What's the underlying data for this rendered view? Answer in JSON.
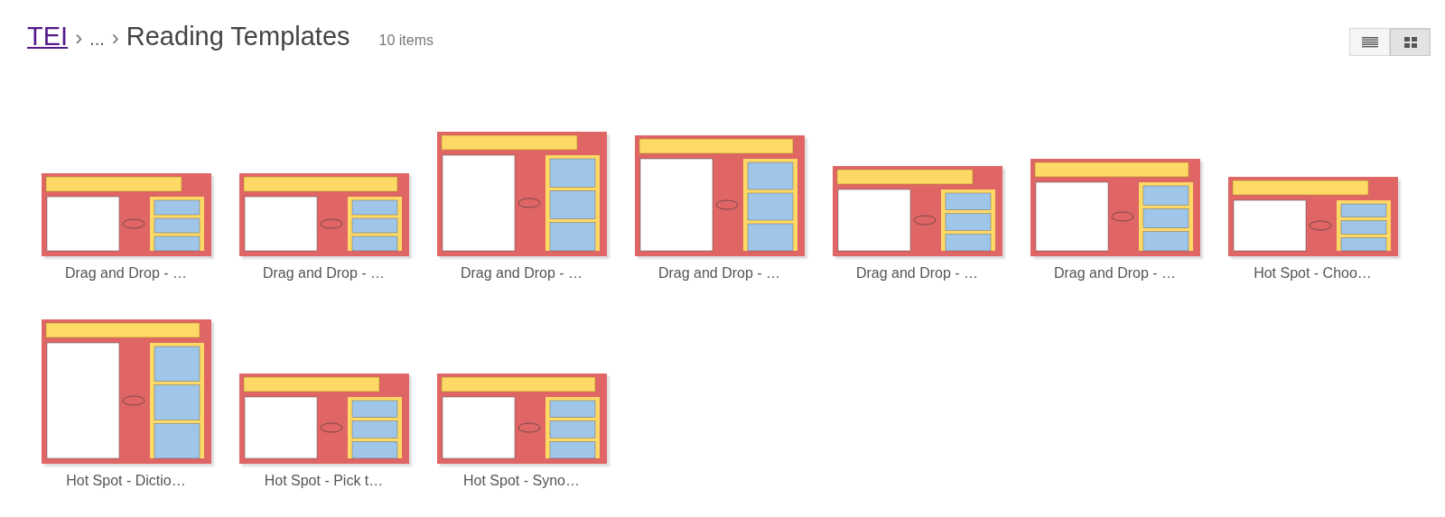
{
  "breadcrumb": {
    "root": "TEI",
    "separator_1": "›",
    "ellipsis": "...",
    "separator_2": "›",
    "current": "Reading Templates"
  },
  "item_count": "10 items",
  "view_toggle": [
    {
      "kind": "list",
      "selected": false
    },
    {
      "kind": "grid",
      "selected": true
    }
  ],
  "items": [
    {
      "title": "Drag and Drop - …",
      "kind": "picture"
    },
    {
      "title": "Drag and Drop - …",
      "kind": "picture"
    },
    {
      "title": "Drag and Drop - …",
      "kind": "picture"
    },
    {
      "title": "Drag and Drop - …",
      "kind": "picture"
    },
    {
      "title": "Drag and Drop - …",
      "kind": "picture"
    },
    {
      "title": "Drag and Drop - …",
      "kind": "picture"
    },
    {
      "title": "Hot Spot - Choo…",
      "kind": "picture"
    },
    {
      "title": "Hot Spot - Dictio…",
      "kind": "picture"
    },
    {
      "title": "Hot Spot - Pick t…",
      "kind": "picture"
    },
    {
      "title": "Hot Spot - Syno…",
      "kind": "picture"
    }
  ]
}
